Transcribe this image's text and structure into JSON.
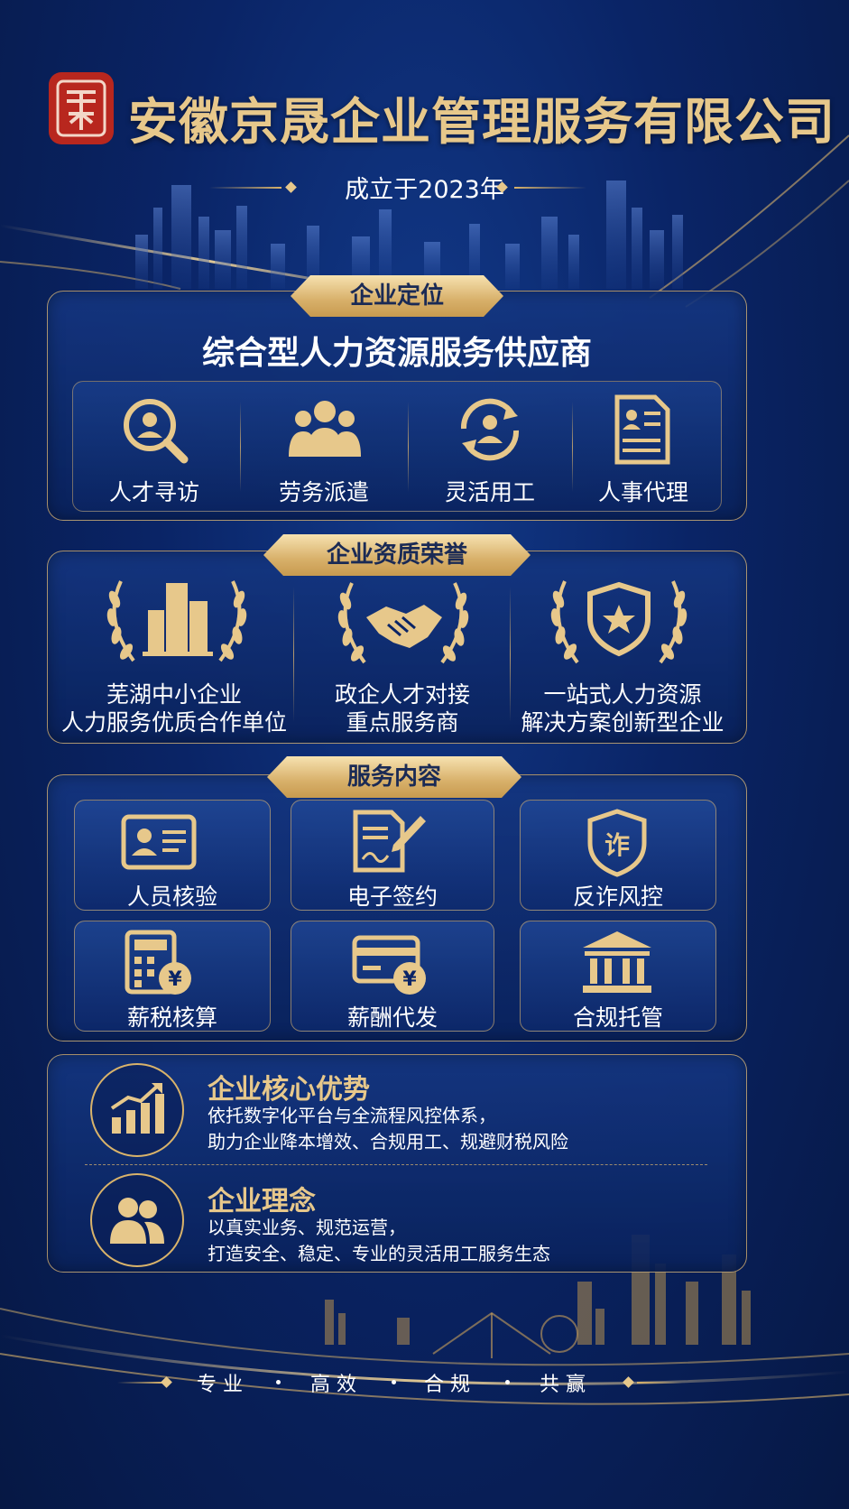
{
  "header": {
    "company_name": "安徽京晟企业管理服务有限公司",
    "founded": "成立于2023年"
  },
  "positioning": {
    "banner": "企业定位",
    "headline": "综合型人力资源服务供应商",
    "items": [
      {
        "label": "人才寻访",
        "icon": "magnifier-person-icon"
      },
      {
        "label": "劳务派遣",
        "icon": "people-group-icon"
      },
      {
        "label": "灵活用工",
        "icon": "person-cycle-icon"
      },
      {
        "label": "人事代理",
        "icon": "document-profile-icon"
      }
    ]
  },
  "honors": {
    "banner": "企业资质荣誉",
    "items": [
      {
        "line1": "芜湖中小企业",
        "line2": "人力服务优质合作单位",
        "icon": "laurel-building-icon"
      },
      {
        "line1": "政企人才对接",
        "line2": "重点服务商",
        "icon": "laurel-handshake-icon"
      },
      {
        "line1": "一站式人力资源",
        "line2": "解决方案创新型企业",
        "icon": "laurel-shield-star-icon"
      }
    ]
  },
  "services": {
    "banner": "服务内容",
    "items": [
      {
        "label": "人员核验",
        "icon": "id-card-icon"
      },
      {
        "label": "电子签约",
        "icon": "e-sign-icon"
      },
      {
        "label": "反诈风控",
        "icon": "anti-fraud-shield-icon"
      },
      {
        "label": "薪税核算",
        "icon": "calculator-yen-icon"
      },
      {
        "label": "薪酬代发",
        "icon": "card-yen-icon"
      },
      {
        "label": "合规托管",
        "icon": "bank-building-icon"
      }
    ]
  },
  "advantages": {
    "core_title": "企业核心优势",
    "core_line1": "依托数字化平台与全流程风控体系，",
    "core_line2": "助力企业降本增效、合规用工、规避财税风险",
    "concept_title": "企业理念",
    "concept_line1": "以真实业务、规范运营，",
    "concept_line2": "打造安全、稳定、专业的灵活用工服务生态",
    "core_icon": "bar-chart-growth-icon",
    "concept_icon": "two-people-icon"
  },
  "footer": {
    "slogans": [
      "专 业",
      "高 效",
      "合 规",
      "共 赢"
    ]
  },
  "colors": {
    "gold": "#e7c88b",
    "navy": "#0a2466",
    "seal_red": "#b8271e"
  }
}
